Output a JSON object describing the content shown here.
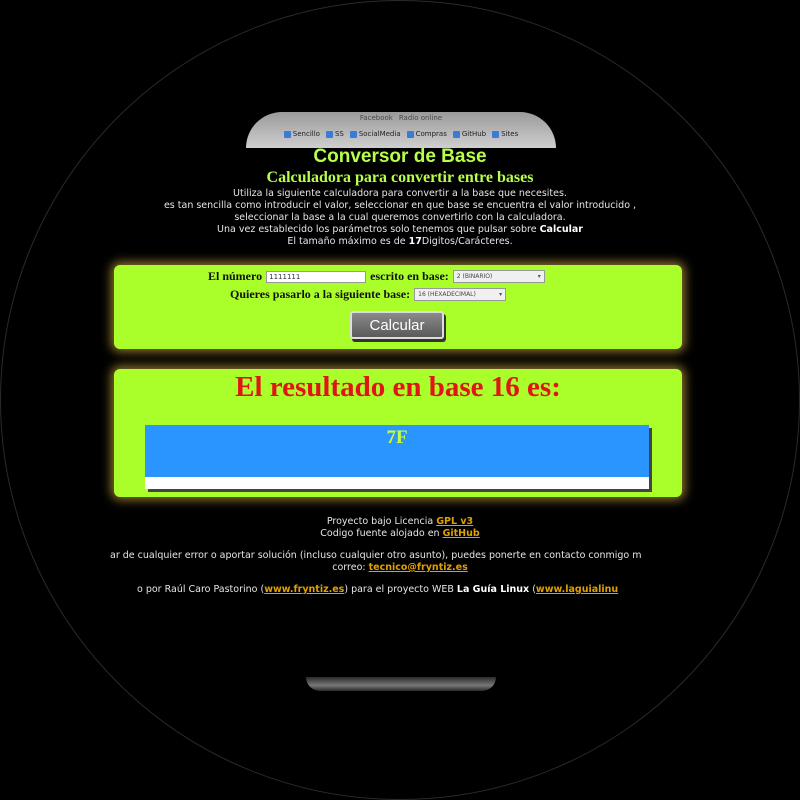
{
  "browser": {
    "tabs": [
      "Facebook",
      "Radio online"
    ],
    "bookmarks": [
      {
        "label": "Sencillo",
        "icon": "bookmark-icon"
      },
      {
        "label": "SS",
        "icon": "bookmark-icon"
      },
      {
        "label": "SocialMedia",
        "icon": "folder-icon"
      },
      {
        "label": "Compras",
        "icon": "bookmark-icon"
      },
      {
        "label": "GitHub",
        "icon": "github-icon"
      },
      {
        "label": "Sites",
        "icon": "bookmark-icon"
      }
    ]
  },
  "header": {
    "title": "Conversor de Base",
    "subtitle": "Calculadora para convertir entre bases",
    "intro_lines": [
      "Utiliza la siguiente calculadora para convertir a la base que necesites.",
      "es tan sencilla como introducir el valor, seleccionar en que base se encuentra el valor introducido ,",
      "seleccionar la base a la cual queremos convertirlo con la calculadora."
    ],
    "intro_params_prefix": "Una vez establecido los parámetros solo tenemos que pulsar sobre ",
    "intro_params_bold": "Calcular",
    "intro_max_prefix": "El tamaño máximo es de ",
    "intro_max_bold": "17",
    "intro_max_suffix": "Digitos/Carácteres."
  },
  "form": {
    "number_label": "El número",
    "number_value": "1111111",
    "written_in_label": "escrito en base:",
    "source_base": "2 (BINARIO)",
    "target_label": "Quieres pasarlo a la siguiente base:",
    "target_base": "16 (HEXADECIMAL)",
    "calc_button": "Calcular"
  },
  "result": {
    "title": "El resultado en base 16 es:",
    "value": "7F"
  },
  "footer": {
    "license_prefix": "Proyecto bajo Licencia ",
    "license_link": "GPL v3",
    "source_prefix": "Codigo fuente alojado en ",
    "source_link": "GitHub",
    "contact_line": "ar de cualquier error o aportar solución (incluso cualquier otro asunto), puedes ponerte en contacto conmigo m",
    "mail_prefix": "correo: ",
    "mail_link": "tecnico@fryntiz.es",
    "credit_prefix": "o por Raúl Caro Pastorino (",
    "credit_link1": "www.fryntiz.es",
    "credit_mid": ") para el proyecto WEB ",
    "credit_bold": "La Guía Linux",
    "credit_paren": " (",
    "credit_link2": "www.laguialinu"
  },
  "colors": {
    "background": "#000000",
    "accent_green": "#aaff2a",
    "title_green": "#b7ff4a",
    "result_red": "#e01515",
    "result_blue": "#2b95ff",
    "link_orange": "#e0a000"
  }
}
